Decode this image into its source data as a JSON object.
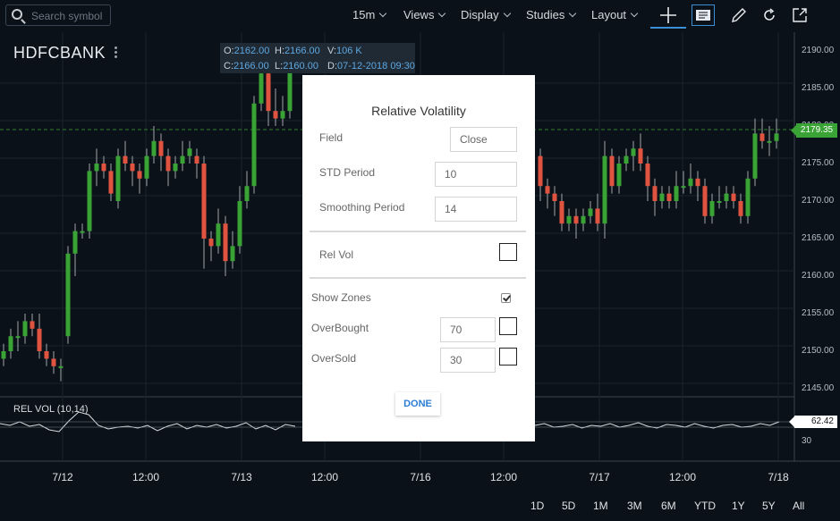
{
  "search": {
    "placeholder": "Search symbol"
  },
  "toolbar": {
    "interval": "15m",
    "views": "Views",
    "display": "Display",
    "studies": "Studies",
    "layout": "Layout"
  },
  "icons": {
    "search": "search-icon",
    "crosshair": "crosshair-icon",
    "legend": "legend-icon",
    "draw": "pencil-icon",
    "refresh": "refresh-icon",
    "share": "share-icon",
    "more": "vertical-dots-icon"
  },
  "symbol": "HDFCBANK",
  "ohlc": {
    "o_label": "O:",
    "o": "2162.00",
    "h_label": "H:",
    "h": "2166.00",
    "v_label": "V:",
    "v": "106 K",
    "c_label": "C:",
    "c": "2166.00",
    "l_label": "L:",
    "l": "2160.00",
    "d_label": "D:",
    "d": "07-12-2018 09:30"
  },
  "price_axis": {
    "ticks": [
      "2190.00",
      "2185.00",
      "2180.00",
      "2175.00",
      "2170.00",
      "2165.00",
      "2160.00",
      "2155.00",
      "2150.00",
      "2145.00"
    ],
    "current_price": "2179.35"
  },
  "rel_vol": {
    "label": "REL VOL (10,14)",
    "value": "62.42",
    "axis_tick": "30"
  },
  "time_axis": [
    "7/12",
    "12:00",
    "7/13",
    "12:00",
    "7/16",
    "12:00",
    "7/17",
    "12:00",
    "7/18"
  ],
  "ranges": [
    "1D",
    "5D",
    "1M",
    "3M",
    "6M",
    "YTD",
    "1Y",
    "5Y",
    "All"
  ],
  "colors": {
    "up": "#3aa335",
    "down": "#e0533f",
    "background": "#0b1118",
    "accent": "#3b8fd6"
  },
  "dialog": {
    "title": "Relative Volatility",
    "field_label": "Field",
    "field_value": "Close",
    "std_label": "STD Period",
    "std_value": "10",
    "smooth_label": "Smoothing Period",
    "smooth_value": "14",
    "relvol_label": "Rel Vol",
    "zones_label": "Show Zones",
    "zones_checked": true,
    "overbought_label": "OverBought",
    "overbought_value": "70",
    "oversold_label": "OverSold",
    "oversold_value": "30",
    "done_label": "DONE"
  }
}
